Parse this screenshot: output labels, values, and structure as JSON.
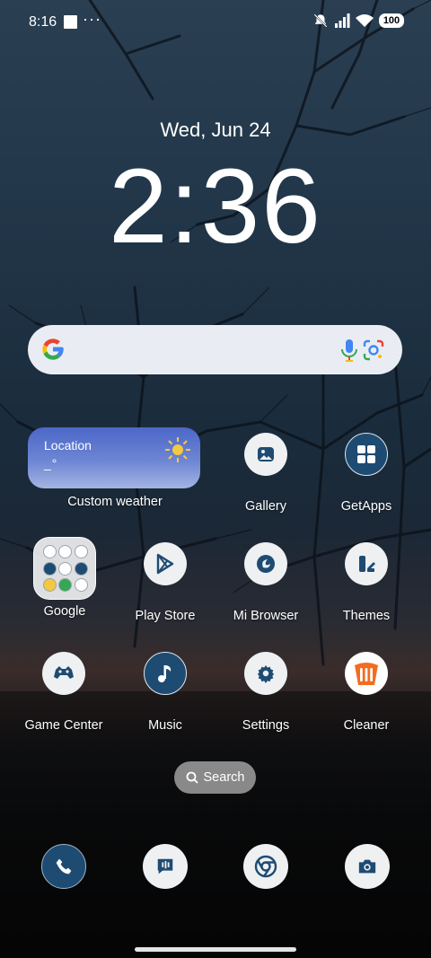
{
  "status_bar": {
    "time": "8:16",
    "overflow": "···",
    "battery": "100"
  },
  "lockclock": {
    "date": "Wed, Jun 24",
    "time": "2:36"
  },
  "weather_widget": {
    "location": "Location",
    "sub": "_°",
    "label": "Custom weather"
  },
  "apps": {
    "row1": [
      "Gallery",
      "GetApps"
    ],
    "row2": [
      "Google",
      "Play Store",
      "Mi Browser",
      "Themes"
    ],
    "row3": [
      "Game Center",
      "Music",
      "Settings",
      "Cleaner"
    ]
  },
  "search_pill": {
    "label": "Search"
  },
  "colors": {
    "accent": "#1e4b72",
    "google_blue": "#4285F4",
    "google_red": "#EA4335",
    "google_yellow": "#FBBC05",
    "google_green": "#34A853",
    "cleaner_orange": "#f26d1f"
  }
}
